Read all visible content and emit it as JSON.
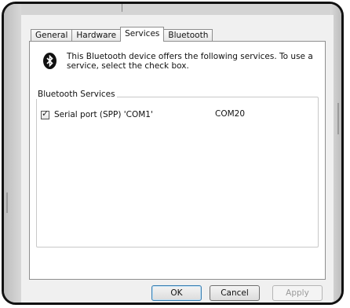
{
  "tabs": [
    {
      "label": "General",
      "active": false
    },
    {
      "label": "Hardware",
      "active": false
    },
    {
      "label": "Services",
      "active": true
    },
    {
      "label": "Bluetooth",
      "active": false
    }
  ],
  "intro_text": "This Bluetooth device offers the following services. To use a service, select the check box.",
  "services_group": {
    "title": "Bluetooth Services",
    "items": [
      {
        "label": "Serial port (SPP) 'COM1'",
        "port": "COM20",
        "checked": true
      }
    ]
  },
  "buttons": {
    "ok": "OK",
    "cancel": "Cancel",
    "apply": "Apply"
  },
  "icons": {
    "service_icon": "bluetooth-icon",
    "check_mark": "✓"
  }
}
